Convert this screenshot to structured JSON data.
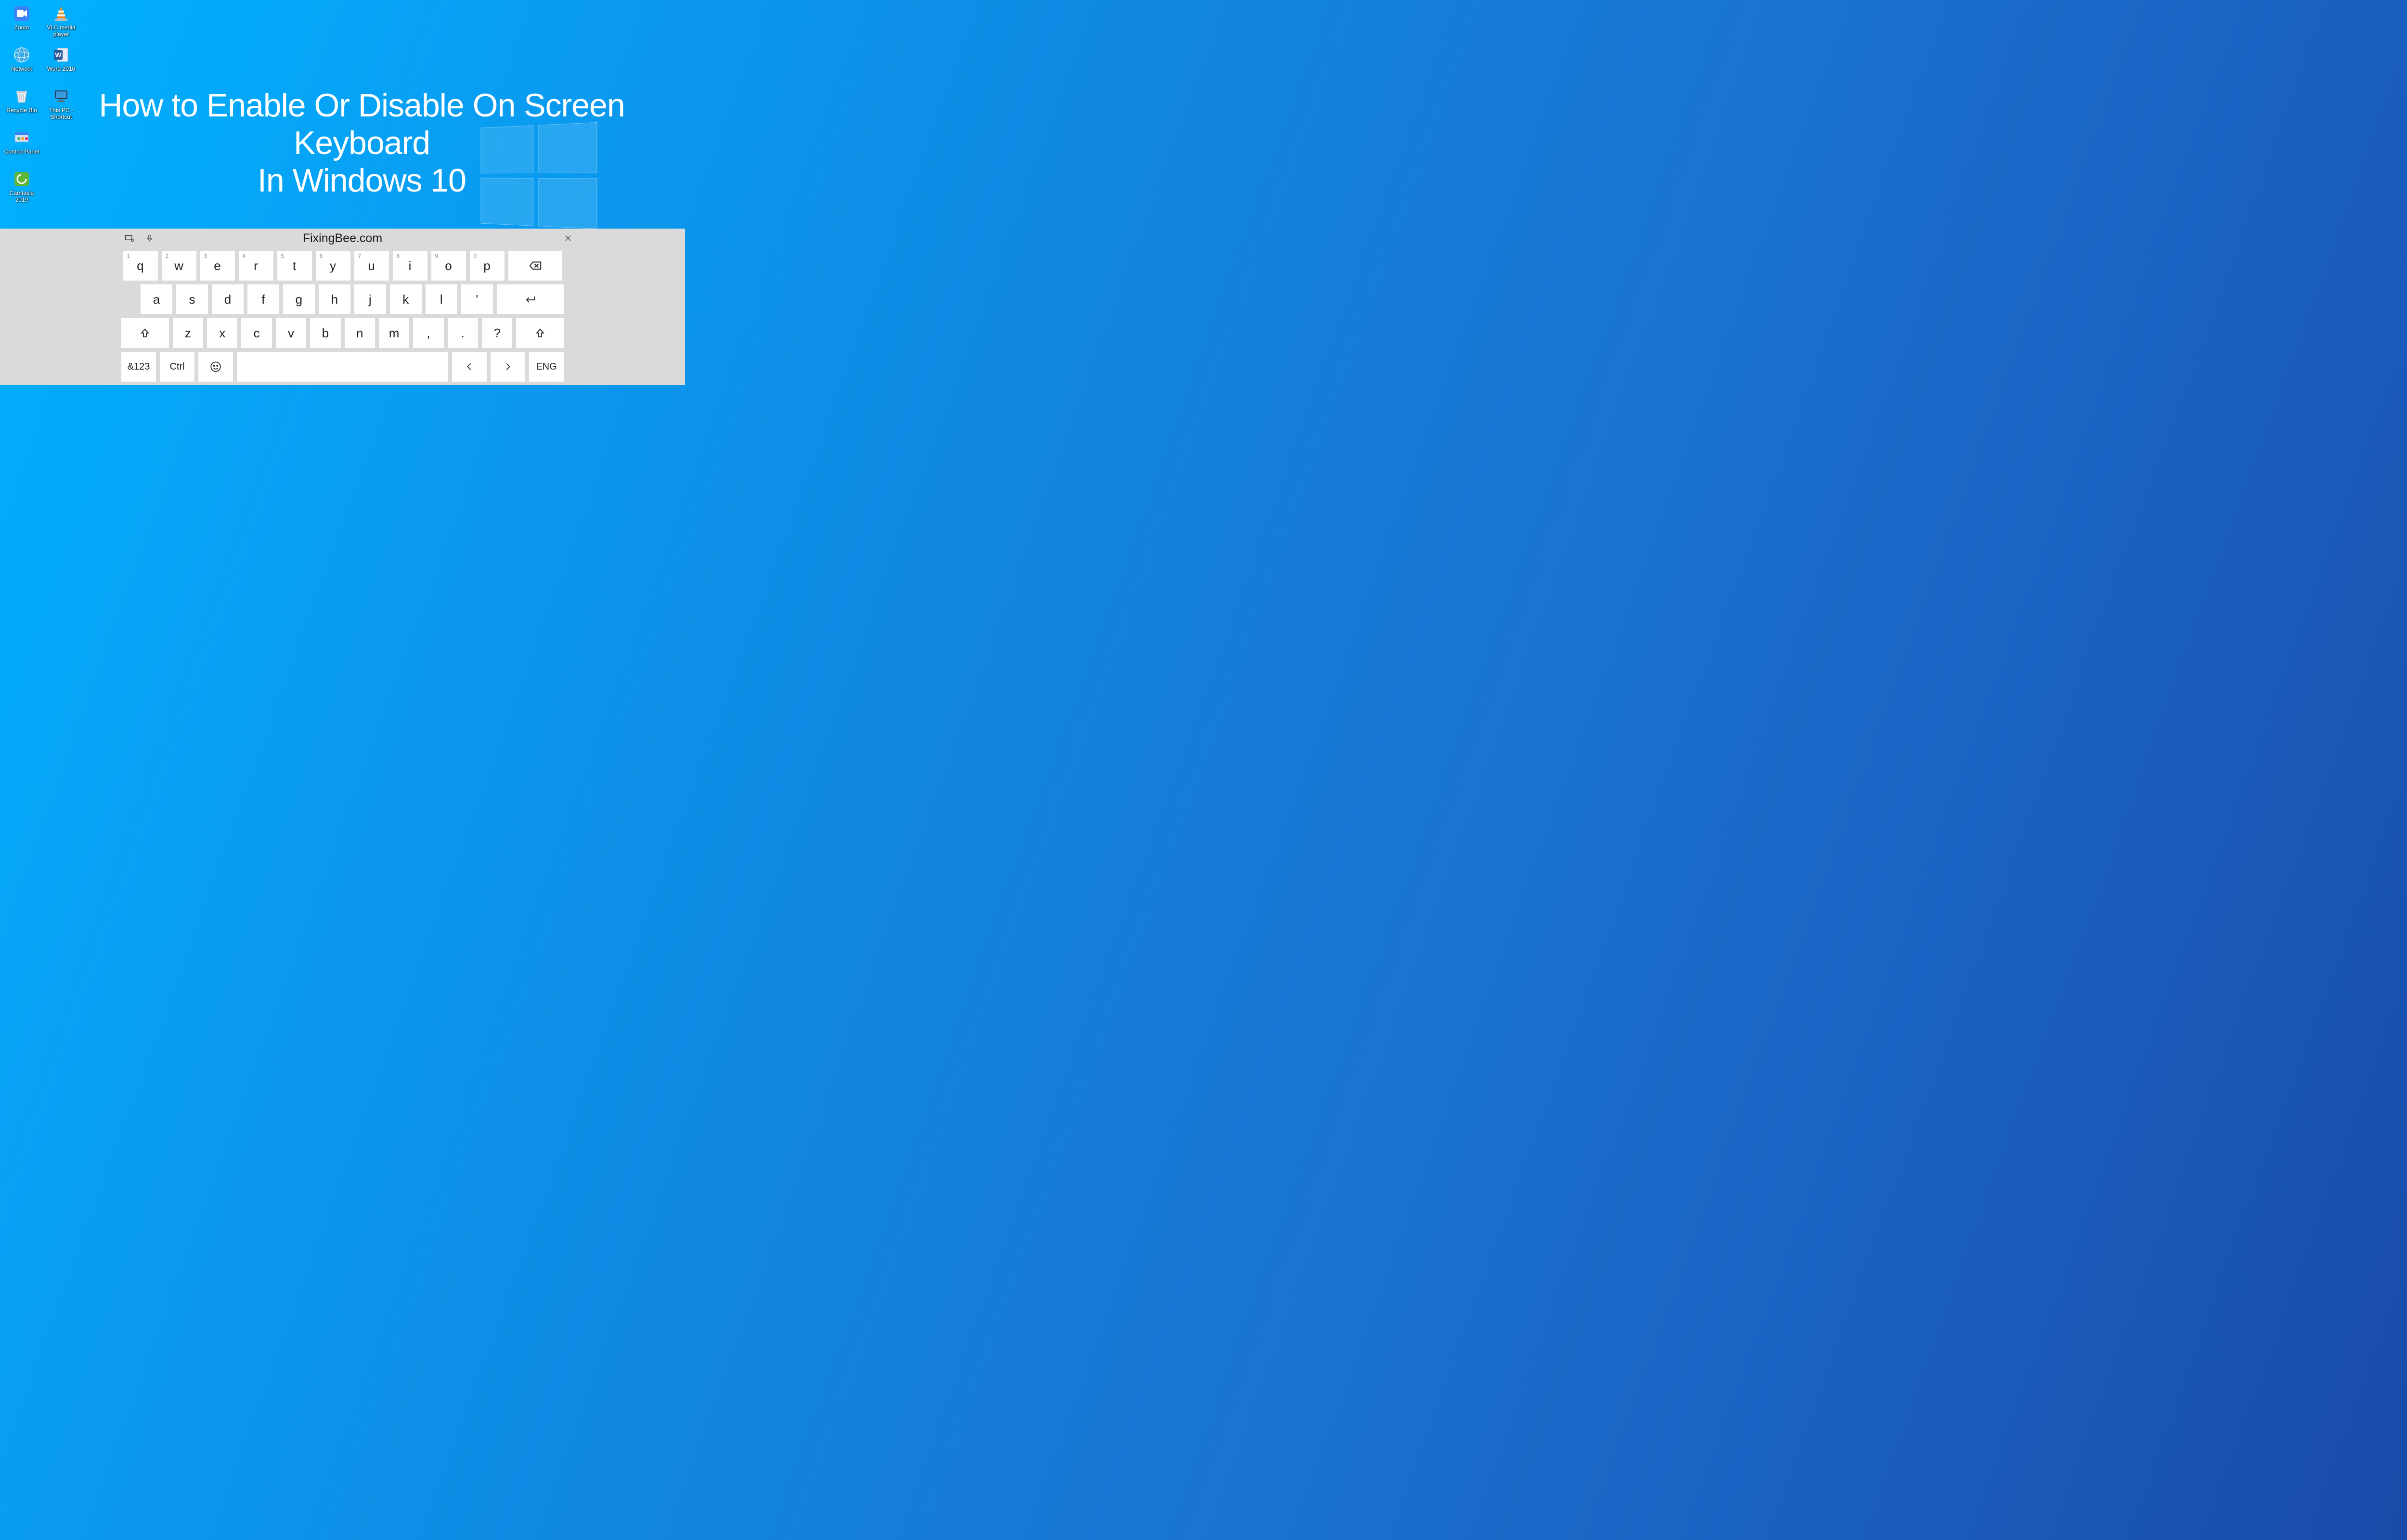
{
  "desktop": {
    "col1": [
      {
        "label": "Zoom",
        "name": "zoom",
        "color": "#3a82f7",
        "glyph": "camera"
      },
      {
        "label": "Network",
        "name": "network",
        "color": "#3ba9e4",
        "glyph": "globe"
      },
      {
        "label": "Recycle Bin",
        "name": "recycle-bin",
        "color": "#e7edf0",
        "glyph": "bin"
      },
      {
        "label": "Control Panel",
        "name": "control-panel",
        "color": "#3a82f7",
        "glyph": "panel"
      },
      {
        "label": "Camtasia 2019",
        "name": "camtasia",
        "color": "#5fb638",
        "glyph": "camtasia"
      }
    ],
    "col2": [
      {
        "label": "VLC media player",
        "name": "vlc",
        "color": "#f08a24",
        "glyph": "cone"
      },
      {
        "label": "Word 2016",
        "name": "word",
        "color": "#2b579a",
        "glyph": "word"
      },
      {
        "label": "This PC - Shortcut",
        "name": "this-pc",
        "color": "#2a3b55",
        "glyph": "monitor"
      }
    ]
  },
  "headline": {
    "line1": "How to Enable Or Disable On Screen Keyboard",
    "line2": "In Windows 10"
  },
  "keyboard": {
    "brand": "FixingBee.com",
    "row1": [
      {
        "main": "q",
        "sup": "1"
      },
      {
        "main": "w",
        "sup": "2"
      },
      {
        "main": "e",
        "sup": "3"
      },
      {
        "main": "r",
        "sup": "4"
      },
      {
        "main": "t",
        "sup": "5"
      },
      {
        "main": "y",
        "sup": "6"
      },
      {
        "main": "u",
        "sup": "7"
      },
      {
        "main": "i",
        "sup": "8"
      },
      {
        "main": "o",
        "sup": "9"
      },
      {
        "main": "p",
        "sup": "0"
      }
    ],
    "backspace": "⌫",
    "row2": [
      "a",
      "s",
      "d",
      "f",
      "g",
      "h",
      "j",
      "k",
      "l",
      "'"
    ],
    "enter": "↵",
    "row3": [
      "z",
      "x",
      "c",
      "v",
      "b",
      "n",
      "m",
      ",",
      ".",
      "?"
    ],
    "shift": "↑",
    "row4": {
      "numsym": "&123",
      "ctrl": "Ctrl",
      "emoji": "☺",
      "left": "〈",
      "right": "〉",
      "lang": "ENG"
    }
  }
}
